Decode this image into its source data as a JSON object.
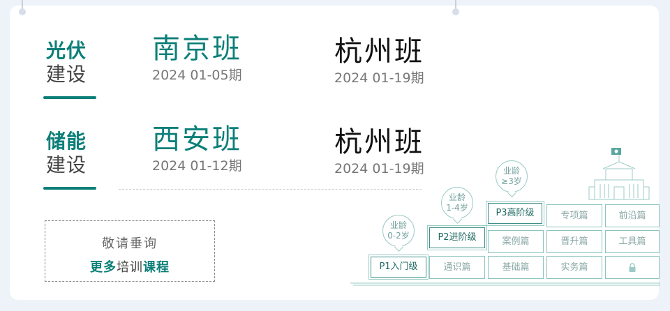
{
  "categories": [
    {
      "line1": "光伏",
      "line2": "建设"
    },
    {
      "line1": "储能",
      "line2": "建设"
    }
  ],
  "classes": [
    {
      "name": "南京班",
      "date": "2024  01-05期"
    },
    {
      "name": "杭州班",
      "date": "2024  01-19期"
    },
    {
      "name": "西安班",
      "date": "2024  01-12期"
    },
    {
      "name": "杭州班",
      "date": "2024  01-19期"
    }
  ],
  "inquiry": {
    "line1": "敬请垂询",
    "part1": "更多",
    "part2": "培训",
    "part3": "课程"
  },
  "levels": [
    {
      "label": "P1入门级",
      "bubble_l1": "业龄",
      "bubble_l2": "0-2岁"
    },
    {
      "label": "P2进阶级",
      "bubble_l1": "业龄",
      "bubble_l2": "1-4岁"
    },
    {
      "label": "P3高阶级",
      "bubble_l1": "业龄",
      "bubble_l2": "≥3岁"
    }
  ],
  "modules": {
    "row_top": [
      "专项篇",
      "前沿篇"
    ],
    "row_mid": [
      "案例篇",
      "晋升篇",
      "工具篇"
    ],
    "row_bottom": [
      "通识篇",
      "基础篇",
      "实务篇"
    ]
  },
  "colors": {
    "accent": "#0b7f78",
    "background": "#eef2f9",
    "line": "#8cc4bf"
  },
  "icons": [
    "lock-icon",
    "building-icon",
    "flag-icon"
  ]
}
